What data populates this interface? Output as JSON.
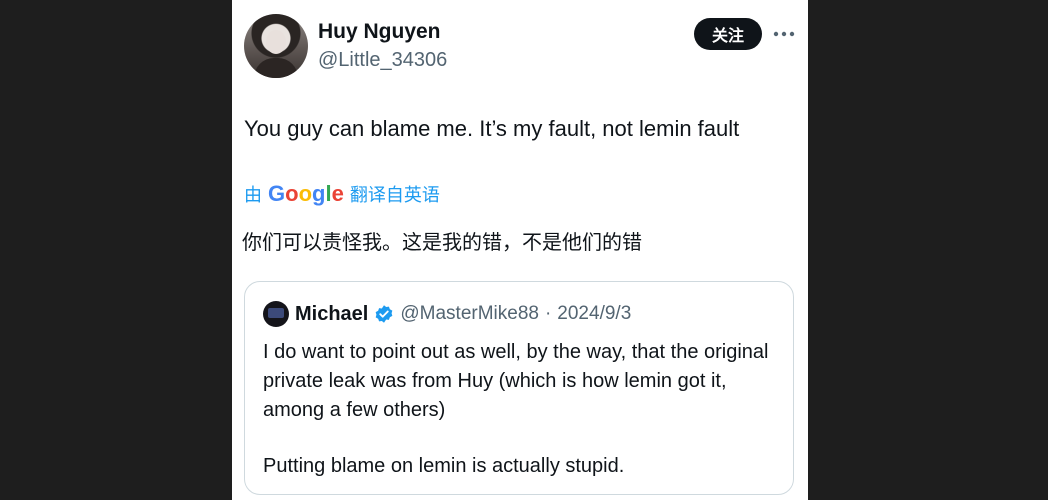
{
  "tweet": {
    "author_name": "Huy Nguyen",
    "author_handle": "@Little_34306",
    "follow_label": "关注",
    "text": "You guy can blame me. It’s my fault, not lemin fault",
    "translate_prefix": "由",
    "translate_provider": "Google",
    "translate_suffix": "翻译自英语",
    "translated_text": "你们可以责怪我。这是我的错，不是他们的错"
  },
  "quoted_tweet": {
    "author_name": "Michael",
    "author_handle": "@MasterMike88",
    "separator": "·",
    "date": "2024/9/3",
    "paragraphs": [
      "I do want to point out as well, by the way, that the original private leak was from Huy (which is how lemin got it, among a few others)",
      "Putting blame on lemin is actually stupid."
    ]
  },
  "icons": {
    "more": "more-horizontal-icon",
    "verified": "verified-badge-icon"
  },
  "colors": {
    "background": "#1e1e1e",
    "card": "#ffffff",
    "text": "#0f1419",
    "secondary": "#536471",
    "accent": "#1d9bf0",
    "button": "#0f1419"
  }
}
